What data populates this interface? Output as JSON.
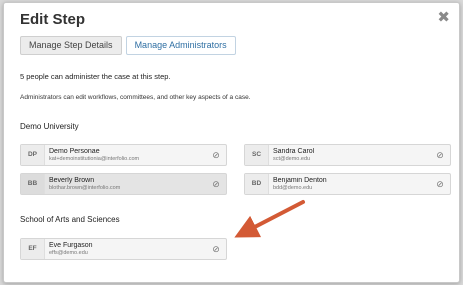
{
  "modal": {
    "title": "Edit Step",
    "close_icon": "close-x-icon"
  },
  "tabs": [
    {
      "label": "Manage Step Details",
      "active": false
    },
    {
      "label": "Manage Administrators",
      "active": true
    }
  ],
  "summary": "5 people can administer the case at this step.",
  "description": "Administrators can edit workflows, committees, and other key aspects of a case.",
  "groups": [
    {
      "name": "Demo University",
      "people": [
        {
          "initials": "DP",
          "name": "Demo Personae",
          "email": "kat+demoinstitutionia@interfolio.com"
        },
        {
          "initials": "SC",
          "name": "Sandra Carol",
          "email": "sct@demo.edu"
        },
        {
          "initials": "BB",
          "name": "Beverly Brown",
          "email": "blothar.brown@interfolio.com"
        },
        {
          "initials": "BD",
          "name": "Benjamin Denton",
          "email": "bdd@demo.edu"
        }
      ]
    },
    {
      "name": "School of Arts and Sciences",
      "people": [
        {
          "initials": "EF",
          "name": "Eve Furgason",
          "email": "effs@demo.edu"
        }
      ]
    }
  ],
  "colors": {
    "annotation_arrow": "#d35a35",
    "active_tab_text": "#2f6fa3"
  },
  "icons": {
    "remove": "remove-circle-icon"
  }
}
